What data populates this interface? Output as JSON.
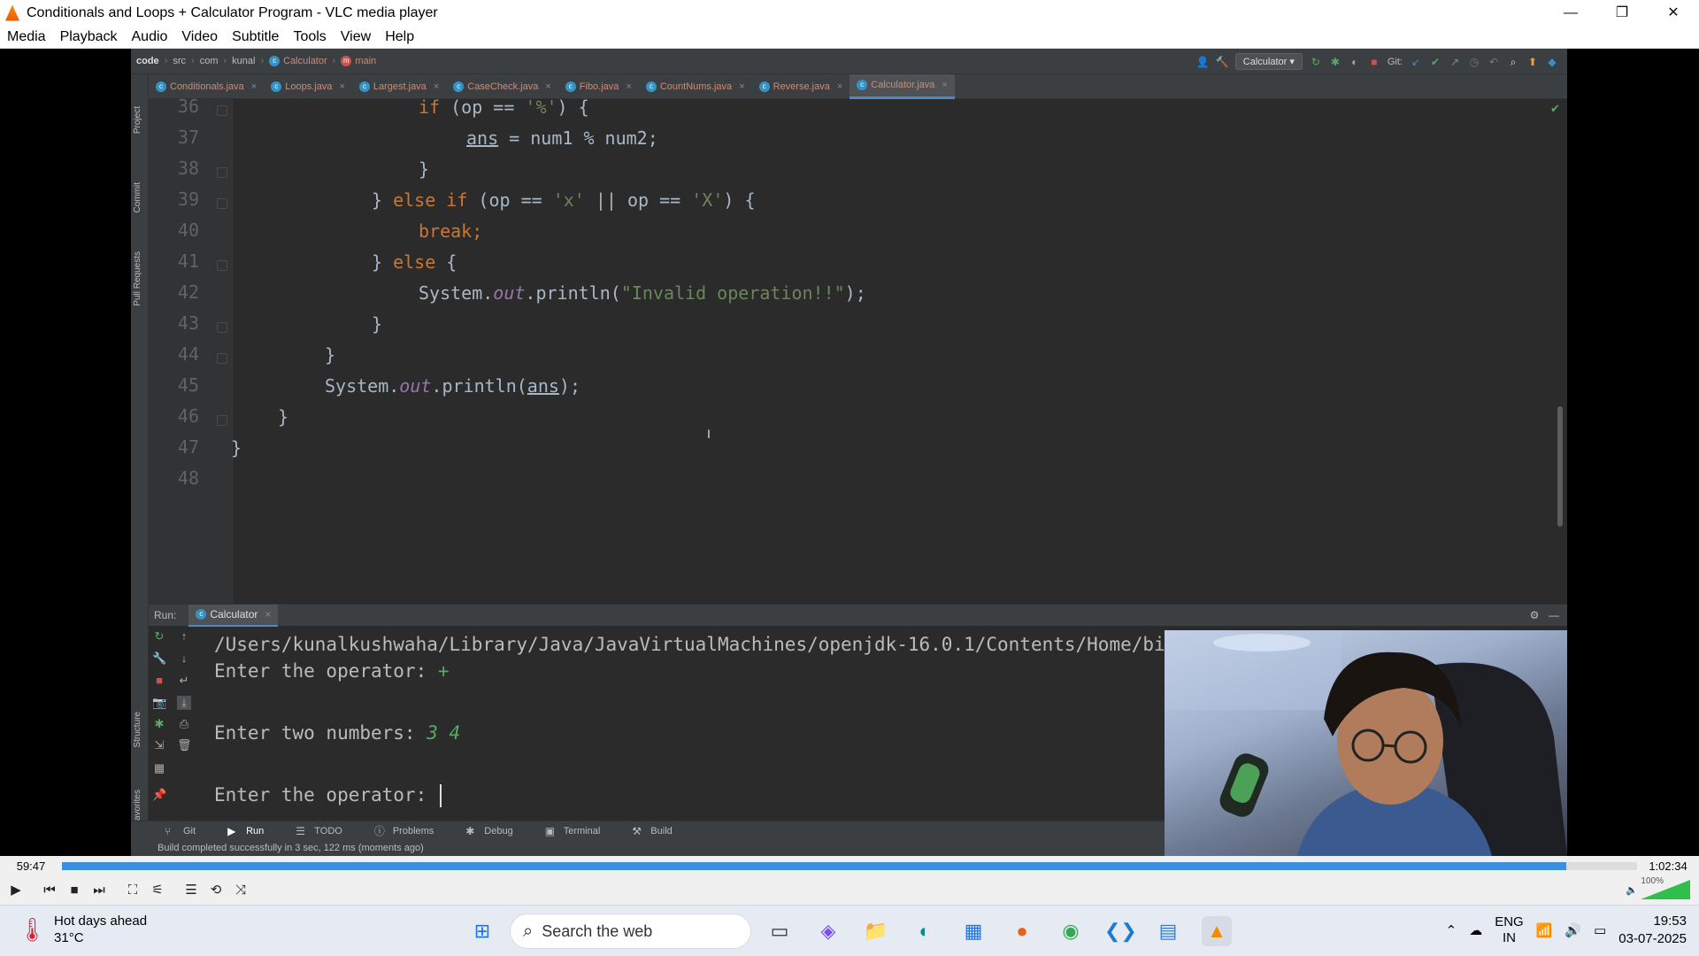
{
  "window": {
    "title": "Conditionals and Loops + Calculator Program - VLC media player",
    "minimize": "—",
    "maximize": "❐",
    "close": "✕"
  },
  "menu": [
    "Media",
    "Playback",
    "Audio",
    "Video",
    "Subtitle",
    "Tools",
    "View",
    "Help"
  ],
  "ide": {
    "breadcrumb": [
      "code",
      "src",
      "com",
      "kunal",
      "Calculator",
      "main"
    ],
    "run_config": "Calculator ▾",
    "git_label": "Git:",
    "tabs": [
      {
        "label": "Conditionals.java",
        "active": false
      },
      {
        "label": "Loops.java",
        "active": false
      },
      {
        "label": "Largest.java",
        "active": false
      },
      {
        "label": "CaseCheck.java",
        "active": false
      },
      {
        "label": "Fibo.java",
        "active": false
      },
      {
        "label": "CountNums.java",
        "active": false
      },
      {
        "label": "Reverse.java",
        "active": false
      },
      {
        "label": "Calculator.java",
        "active": true
      }
    ],
    "side_labels": [
      "Project",
      "Commit",
      "Pull Requests",
      "Structure",
      "Favorites"
    ],
    "line_numbers": [
      "36",
      "37",
      "38",
      "39",
      "40",
      "41",
      "42",
      "43",
      "44",
      "45",
      "46",
      "47",
      "48"
    ],
    "code": {
      "l36_kw": "if",
      "l36_a": " (op == ",
      "l36_str": "'%'",
      "l36_b": ") {",
      "l37_var": "ans",
      "l37_rest": " = num1 % num2;",
      "l38": "}",
      "l39_a": "} ",
      "l39_kw": "else if",
      "l39_b": " (op == ",
      "l39_s1": "'x'",
      "l39_c": " || op == ",
      "l39_s2": "'X'",
      "l39_d": ") {",
      "l40_kw": "break",
      "l40_rest": ";",
      "l41_a": "} ",
      "l41_kw": "else",
      "l41_b": " {",
      "l42_a": "System.",
      "l42_fld": "out",
      "l42_b": ".println(",
      "l42_str": "\"Invalid operation!!\"",
      "l42_c": ");",
      "l43": "}",
      "l44": "}",
      "l45_a": "System.",
      "l45_fld": "out",
      "l45_b": ".println(",
      "l45_var": "ans",
      "l45_c": ");",
      "l46": "}",
      "l47": "}"
    },
    "run_panel": {
      "run_label": "Run:",
      "tab_label": "Calculator",
      "console": {
        "path": "/Users/kunalkushwaha/Library/Java/JavaVirtualMachines/openjdk-16.0.1/Contents/Home/bin/java -javaagent:/Application",
        "prompt1": "Enter the operator: ",
        "input1": "+",
        "prompt2": "Enter two numbers: ",
        "input2": "3 4",
        "prompt3": "Enter the operator: "
      }
    },
    "tool_windows": [
      "Git",
      "Run",
      "TODO",
      "Problems",
      "Debug",
      "Terminal",
      "Build"
    ],
    "status": "Build completed successfully in 3 sec, 122 ms (moments ago)"
  },
  "player": {
    "elapsed": "59:47",
    "total": "1:02:34",
    "progress": 0.955,
    "volume": "100%"
  },
  "taskbar": {
    "weather_title": "Hot days ahead",
    "weather_temp": "31°C",
    "search_placeholder": "Search the web",
    "lang1": "ENG",
    "lang2": "IN",
    "time": "19:53",
    "date": "03-07-2025"
  }
}
